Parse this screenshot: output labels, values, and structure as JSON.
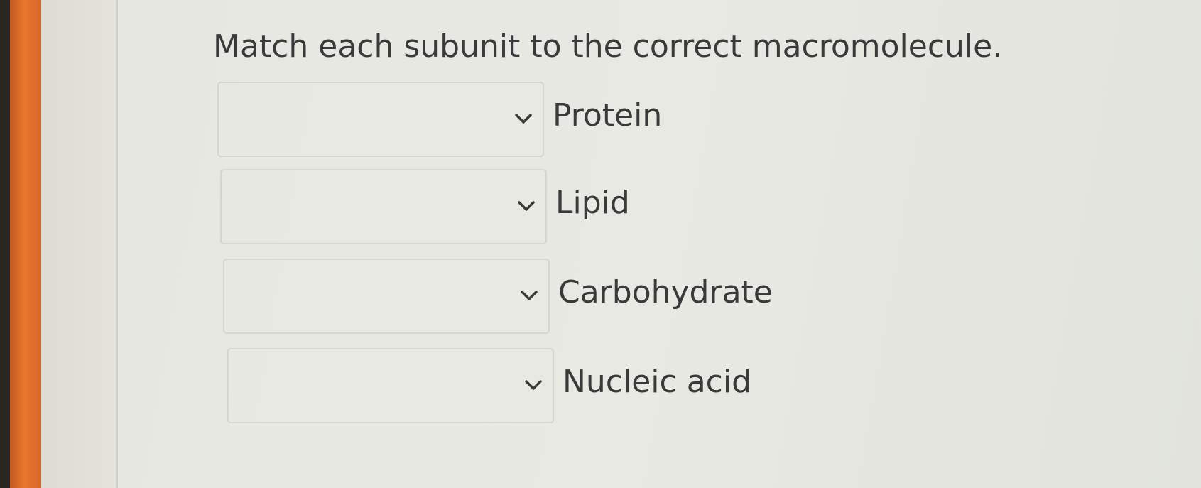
{
  "question": {
    "text": "Match each subunit to the correct macromolecule."
  },
  "matches": [
    {
      "term": "Protein",
      "selected": "",
      "icon": "chevron-down-icon"
    },
    {
      "term": "Lipid",
      "selected": "",
      "icon": "chevron-down-icon"
    },
    {
      "term": "Carbohydrate",
      "selected": "",
      "icon": "chevron-down-icon"
    },
    {
      "term": "Nucleic acid",
      "selected": "",
      "icon": "chevron-down-icon"
    }
  ],
  "colors": {
    "accent_bar": "#e8772e",
    "text": "#3a3a3a",
    "box_border": "#d6d6cf"
  }
}
